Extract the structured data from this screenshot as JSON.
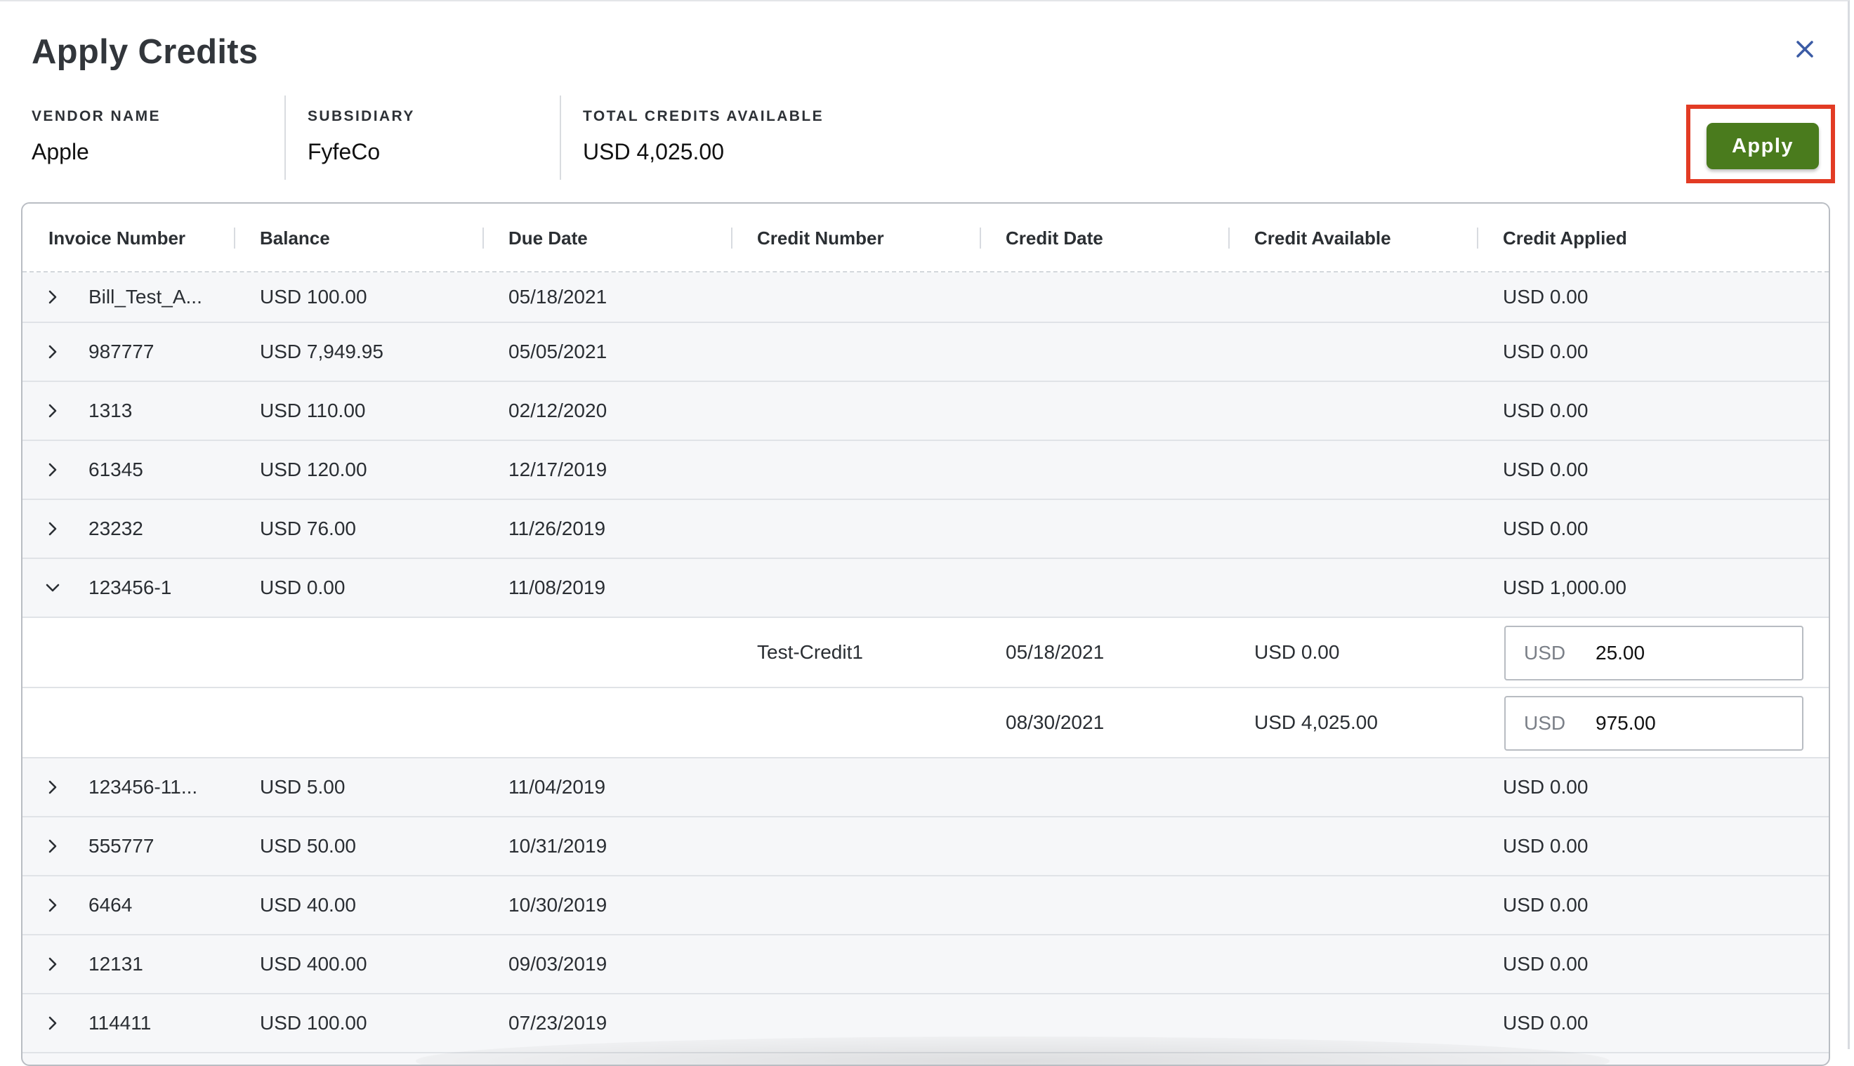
{
  "dialog": {
    "title": "Apply Credits",
    "apply_label": "Apply",
    "accent_color": "#4a7b1d",
    "highlight_color": "#e23b24"
  },
  "summary": {
    "vendor_label": "VENDOR NAME",
    "vendor_value": "Apple",
    "subsidiary_label": "SUBSIDIARY",
    "subsidiary_value": "FyfeCo",
    "credits_label": "TOTAL CREDITS AVAILABLE",
    "credits_value": "USD 4,025.00"
  },
  "table": {
    "headers": {
      "invoice": "Invoice Number",
      "balance": "Balance",
      "due": "Due Date",
      "credit_number": "Credit Number",
      "credit_date": "Credit Date",
      "credit_available": "Credit Available",
      "credit_applied": "Credit Applied"
    },
    "rows": [
      {
        "invoice": "Bill_Test_A...",
        "balance": "USD 100.00",
        "due": "05/18/2021",
        "applied": "USD 0.00",
        "expanded": false
      },
      {
        "invoice": "987777",
        "balance": "USD 7,949.95",
        "due": "05/05/2021",
        "applied": "USD 0.00",
        "expanded": false
      },
      {
        "invoice": "1313",
        "balance": "USD 110.00",
        "due": "02/12/2020",
        "applied": "USD 0.00",
        "expanded": false
      },
      {
        "invoice": "61345",
        "balance": "USD 120.00",
        "due": "12/17/2019",
        "applied": "USD 0.00",
        "expanded": false
      },
      {
        "invoice": "23232",
        "balance": "USD 76.00",
        "due": "11/26/2019",
        "applied": "USD 0.00",
        "expanded": false
      },
      {
        "invoice": "123456-1",
        "balance": "USD 0.00",
        "due": "11/08/2019",
        "applied": "USD 1,000.00",
        "expanded": true
      },
      {
        "invoice": "123456-11...",
        "balance": "USD 5.00",
        "due": "11/04/2019",
        "applied": "USD 0.00",
        "expanded": false
      },
      {
        "invoice": "555777",
        "balance": "USD 50.00",
        "due": "10/31/2019",
        "applied": "USD 0.00",
        "expanded": false
      },
      {
        "invoice": "6464",
        "balance": "USD 40.00",
        "due": "10/30/2019",
        "applied": "USD 0.00",
        "expanded": false
      },
      {
        "invoice": "12131",
        "balance": "USD 400.00",
        "due": "09/03/2019",
        "applied": "USD 0.00",
        "expanded": false
      },
      {
        "invoice": "114411",
        "balance": "USD 100.00",
        "due": "07/23/2019",
        "applied": "USD 0.00",
        "expanded": false
      }
    ],
    "credit_lines": [
      {
        "credit_number": "Test-Credit1",
        "credit_date": "05/18/2021",
        "credit_available": "USD 0.00",
        "currency": "USD",
        "amount": "25.00"
      },
      {
        "credit_number": "",
        "credit_date": "08/30/2021",
        "credit_available": "USD 4,025.00",
        "currency": "USD",
        "amount": "975.00"
      }
    ]
  }
}
